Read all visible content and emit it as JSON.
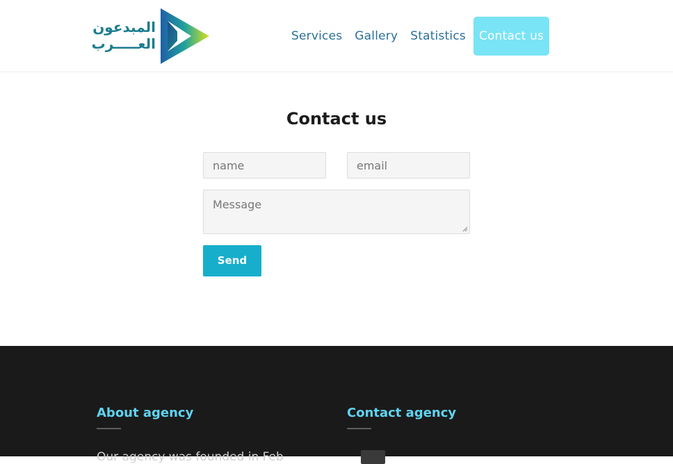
{
  "header": {
    "logo": {
      "text_line1": "المبدعون",
      "text_line2": "العـــــرب"
    },
    "nav": [
      {
        "label": "Services"
      },
      {
        "label": "Gallery"
      },
      {
        "label": "Statistics"
      },
      {
        "label": "Contact us",
        "active": true
      }
    ]
  },
  "contact": {
    "title": "Contact us",
    "name_placeholder": "name",
    "email_placeholder": "email",
    "message_placeholder": "Message",
    "send_label": "Send"
  },
  "footer": {
    "about_heading": "About agency",
    "contact_heading": "Contact agency",
    "about_text": "Our agency was founded in Feb",
    "contact_icon": "phone-icon"
  },
  "colors": {
    "accent": "#17aecb",
    "nav_text": "#2a6f99",
    "active_nav_bg": "#79e4f5",
    "footer_bg": "#1a1a1a",
    "footer_heading": "#5fd3f0"
  }
}
